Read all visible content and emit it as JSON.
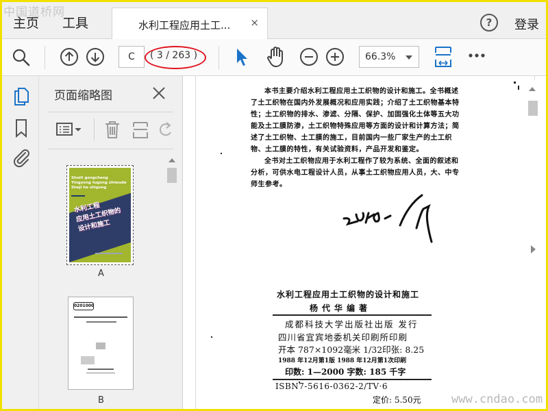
{
  "watermarks": {
    "top": "中国道桥网",
    "bottom": "www.cndao.com"
  },
  "tabbar": {
    "home": "主页",
    "tools": "工具",
    "doc_tab_title": "水利工程应用土工...",
    "close_glyph": "×",
    "help_glyph": "?",
    "login": "登录"
  },
  "toolbar": {
    "page_input_value": "C",
    "page_count": "( 3 / 263 )",
    "zoom": "66.3%",
    "icons": [
      "search-icon",
      "page-up-icon",
      "page-down-icon",
      "select-pointer-icon",
      "hand-icon",
      "zoom-out-icon",
      "zoom-in-icon",
      "fit-page-icon",
      "more-icon"
    ]
  },
  "accent_color": "#1a73c8",
  "thumbnails": {
    "title": "页面缩略图",
    "items": [
      {
        "label": "A",
        "cover_pinyin_1": "Shuili gongcheng",
        "cover_pinyin_2": "Yingyong tugong zhiwude",
        "cover_pinyin_3": "Sheji he shigong",
        "cover_title_1": "水利工程",
        "cover_title_2": "应用土工织物的",
        "cover_title_3": "设计和施工"
      },
      {
        "label": "B",
        "stamp": "0201000"
      }
    ]
  },
  "document": {
    "intro_paragraphs": [
      "本书主要介绍水利工程应用土工织物的设计和施工。全书概述了土工织物在国内外发展概况和应用实践；介绍了土工织物基本特性；土工织物的排水、渗滤、分隔、保护、加固强化土体等五大功能及土工膜防渗，土工织物特殊应用等方面的设计和计算方法；简述了土工织物、土工膜的施工，目前国内一些厂家生产的土工织物、土工膜的特性，有关试验资料，产品开发和鉴定。",
      "全书对土工织物应用于水利工程作了较为系统、全面的叙述和分析，可供水电工程设计人员，从事土工织物应用人员，大、中专师生参考。"
    ],
    "signature": "ZU48/17",
    "colophon": {
      "title": "水利工程应用土工织物的设计和施工",
      "author": "杨代华编著",
      "publisher": "成都科技大学出版社出版 发行",
      "printer": "四川省宜宾地委机关印刷所印刷",
      "size": "开本 787×1092毫米 1/32印张: 8.25",
      "edition": "1988 年12月第1版   1988 年12月第1次印刷",
      "print_count": "印数: 1—2000  字数: 185 千字",
      "isbn": "ISBN7-5616-0362-2/TV·6",
      "price": "定价: 5.50元"
    }
  }
}
